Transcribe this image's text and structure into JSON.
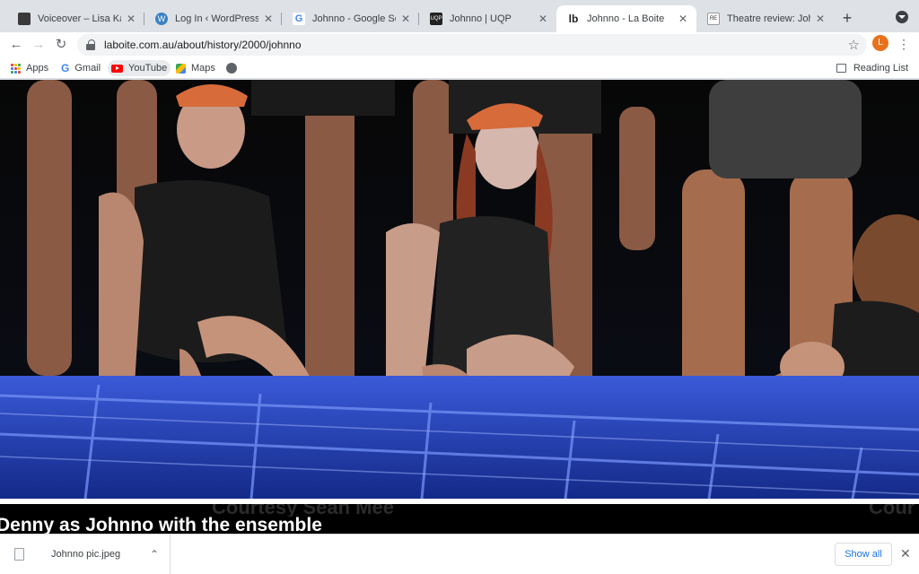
{
  "tabs": [
    {
      "title": "Voiceover – Lisa Kate L",
      "favicon": "lisa-kate-favicon",
      "active": false
    },
    {
      "title": "Log In ‹ WordPress.c",
      "favicon": "wordpress-icon",
      "active": false
    },
    {
      "title": "Johnno - Google Search",
      "favicon": "google-icon",
      "active": false
    },
    {
      "title": "Johnno | UQP",
      "favicon": "uqp-icon",
      "active": false
    },
    {
      "title": "Johnno - La Boite",
      "favicon": "la-boite-icon",
      "active": true
    },
    {
      "title": "Theatre review: Johnno",
      "favicon": "news-icon",
      "active": false
    }
  ],
  "toolbar": {
    "url": "laboite.com.au/about/history/2000/johnno",
    "profile_initial": "L"
  },
  "bookmarks": {
    "items": [
      {
        "label": "Apps",
        "icon": "apps-grid-icon"
      },
      {
        "label": "Gmail",
        "icon": "google-icon"
      },
      {
        "label": "YouTube",
        "icon": "youtube-icon"
      },
      {
        "label": "Maps",
        "icon": "maps-icon"
      },
      {
        "label": "",
        "icon": "globe-icon"
      }
    ],
    "reading_list": "Reading List"
  },
  "content": {
    "credit_left": "Courtesy Sean Mee",
    "credit_right": "Cour",
    "caption": "Denny as Johnno with the ensemble"
  },
  "downloads": {
    "file_name": "Johnno pic.jpeg",
    "show_all": "Show all"
  },
  "colors": {
    "tabstrip": "#dee1e6",
    "accent_blue": "#1a73e8",
    "profile": "#e8711c"
  }
}
